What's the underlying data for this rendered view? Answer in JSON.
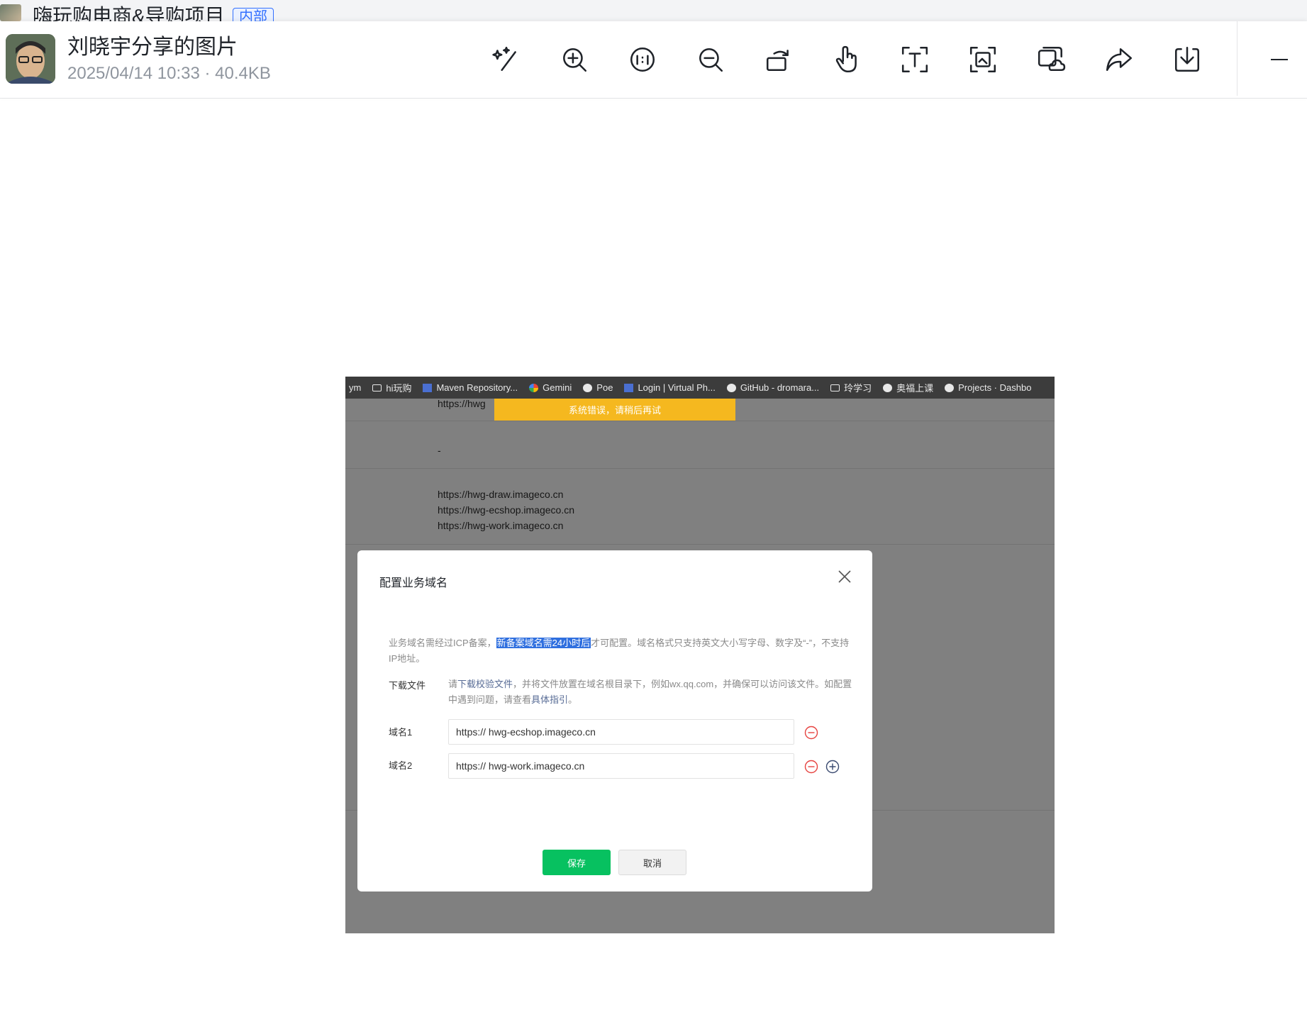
{
  "chat": {
    "title": "嗨玩购电商&导购项目",
    "tag": "内部"
  },
  "viewer": {
    "title": "刘晓宇分享的图片",
    "meta": "2025/04/14 10:33 · 40.4KB",
    "tools": [
      {
        "name": "ai-enhance-icon"
      },
      {
        "name": "zoom-in-icon"
      },
      {
        "name": "actual-size-icon"
      },
      {
        "name": "zoom-out-icon"
      },
      {
        "name": "rotate-icon"
      },
      {
        "name": "hand-icon"
      },
      {
        "name": "text-extract-icon"
      },
      {
        "name": "screenshot-icon"
      },
      {
        "name": "save-to-cloud-icon"
      },
      {
        "name": "forward-icon"
      },
      {
        "name": "download-icon"
      }
    ]
  },
  "screenshot": {
    "bookmarks": [
      {
        "label": "ym",
        "icon": "none"
      },
      {
        "label": "hi玩购",
        "icon": "folder"
      },
      {
        "label": "Maven Repository...",
        "icon": "square"
      },
      {
        "label": "Gemini",
        "icon": "google"
      },
      {
        "label": "Poe",
        "icon": "circle"
      },
      {
        "label": "Login | Virtual Ph...",
        "icon": "square"
      },
      {
        "label": "GitHub - dromara...",
        "icon": "circle"
      },
      {
        "label": "玲学习",
        "icon": "folder"
      },
      {
        "label": "奥福上课",
        "icon": "circle"
      },
      {
        "label": "Projects · Dashbo",
        "icon": "circle"
      }
    ],
    "bg_url_partial": "https://hwg",
    "toast": "系统错误，请稍后再试",
    "dash": "-",
    "domain_lines": [
      "https://hwg-draw.imageco.cn",
      "https://hwg-ecshop.imageco.cn",
      "https://hwg-work.imageco.cn"
    ],
    "modal": {
      "title": "配置业务域名",
      "notice_pre": "业务域名需经过ICP备案，",
      "notice_highlight": "新备案域名需24小时后",
      "notice_post": "才可配置。域名格式只支持英文大小写字母、数字及“-”，不支持IP地址。",
      "download_label": "下载文件",
      "download_pre": "请",
      "download_link": "下载校验文件",
      "download_mid": "，并将文件放置在域名根目录下，例如wx.qq.com，并确保可以访问该文件。如配置中遇到问题，请查看",
      "download_link2": "具体指引",
      "download_post": "。",
      "domain1_label": "域名1",
      "domain1_value": "https:// hwg-ecshop.imageco.cn",
      "domain2_label": "域名2",
      "domain2_value": "https:// hwg-work.imageco.cn",
      "save_label": "保存",
      "cancel_label": "取消"
    }
  }
}
